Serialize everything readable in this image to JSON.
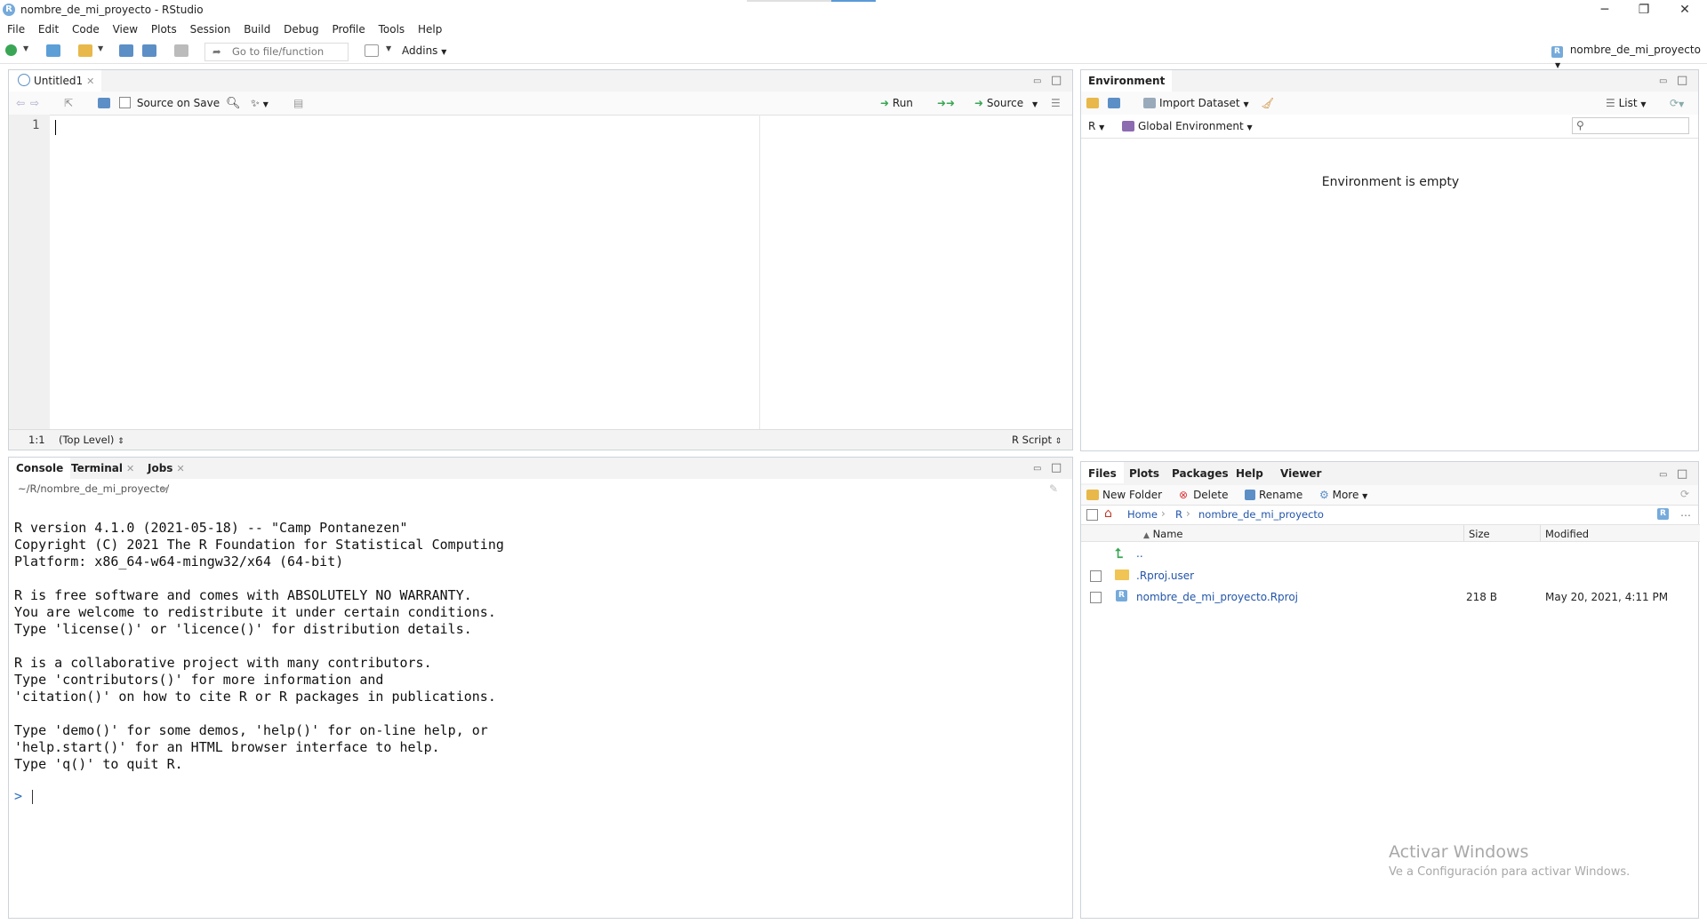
{
  "window": {
    "title": "nombre_de_mi_proyecto - RStudio",
    "minimize": "─",
    "maximize": "❐",
    "close": "✕"
  },
  "menu": [
    "File",
    "Edit",
    "Code",
    "View",
    "Plots",
    "Session",
    "Build",
    "Debug",
    "Profile",
    "Tools",
    "Help"
  ],
  "toolbar": {
    "goto_placeholder": "Go to file/function",
    "addins": "Addins",
    "project": "nombre_de_mi_proyecto"
  },
  "source_pane": {
    "tab": "Untitled1",
    "source_on_save": "Source on Save",
    "run": "Run",
    "source": "Source",
    "line_number": "1",
    "position": "1:1",
    "scope": "(Top Level)",
    "file_type": "R Script"
  },
  "console_pane": {
    "tabs": [
      "Console",
      "Terminal",
      "Jobs"
    ],
    "path": "~/R/nombre_de_mi_proyecto/",
    "lines": [
      "R version 4.1.0 (2021-05-18) -- \"Camp Pontanezen\"",
      "Copyright (C) 2021 The R Foundation for Statistical Computing",
      "Platform: x86_64-w64-mingw32/x64 (64-bit)",
      "",
      "R is free software and comes with ABSOLUTELY NO WARRANTY.",
      "You are welcome to redistribute it under certain conditions.",
      "Type 'license()' or 'licence()' for distribution details.",
      "",
      "R is a collaborative project with many contributors.",
      "Type 'contributors()' for more information and",
      "'citation()' on how to cite R or R packages in publications.",
      "",
      "Type 'demo()' for some demos, 'help()' for on-line help, or",
      "'help.start()' for an HTML browser interface to help.",
      "Type 'q()' to quit R."
    ],
    "prompt": ">"
  },
  "env_pane": {
    "tab": "Environment",
    "import_dataset": "Import Dataset",
    "list": "List",
    "r_label": "R",
    "global_env": "Global Environment",
    "empty_msg": "Environment is empty"
  },
  "files_pane": {
    "tabs": [
      "Files",
      "Plots",
      "Packages",
      "Help",
      "Viewer"
    ],
    "new_folder": "New Folder",
    "delete": "Delete",
    "rename": "Rename",
    "more": "More",
    "breadcrumb": [
      "Home",
      "R",
      "nombre_de_mi_proyecto"
    ],
    "columns": {
      "name": "Name",
      "size": "Size",
      "modified": "Modified"
    },
    "parent": "..",
    "rows": [
      {
        "name": ".Rproj.user",
        "size": "",
        "modified": "",
        "type": "folder"
      },
      {
        "name": "nombre_de_mi_proyecto.Rproj",
        "size": "218 B",
        "modified": "May 20, 2021, 4:11 PM",
        "type": "rproj"
      }
    ]
  },
  "watermark": {
    "line1": "Activar Windows",
    "line2": "Ve a Configuración para activar Windows."
  }
}
